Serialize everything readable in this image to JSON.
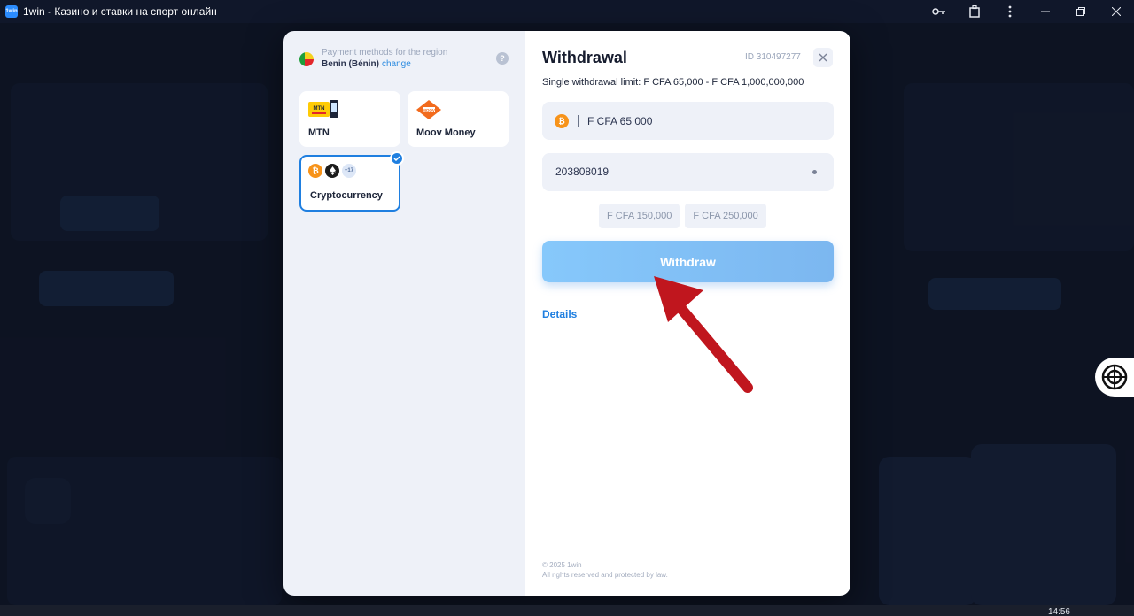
{
  "window": {
    "title": "1win - Казино и ставки на спорт онлайн",
    "app_icon_text": "1win"
  },
  "region": {
    "label": "Payment methods for the region",
    "country": "Benin (Bénin)",
    "change_label": "change"
  },
  "methods": [
    {
      "label": "MTN",
      "icon": "mtn-logo"
    },
    {
      "label": "Moov Money",
      "icon": "moov-money-logo"
    },
    {
      "label": "Cryptocurrency",
      "icon": "crypto-coins",
      "selected": true,
      "more_badge": "+17"
    }
  ],
  "withdrawal": {
    "title": "Withdrawal",
    "id_label": "ID 310497277",
    "limit_text": "Single withdrawal limit: F CFA 65,000 - F CFA 1,000,000,000",
    "amount_value": "F CFA 65 000",
    "address_value": "203808019",
    "quick_amounts": [
      "F CFA 150,000",
      "F CFA 250,000"
    ],
    "withdraw_button": "Withdraw",
    "details_link": "Details"
  },
  "footer": {
    "copyright": "© 2025 1win",
    "rights": "All rights reserved and protected by law."
  },
  "taskbar": {
    "time": "14:56"
  },
  "colors": {
    "accent": "#1f7fe0",
    "withdraw_button": "#86c8fb",
    "annotation_arrow": "#c0161e"
  }
}
